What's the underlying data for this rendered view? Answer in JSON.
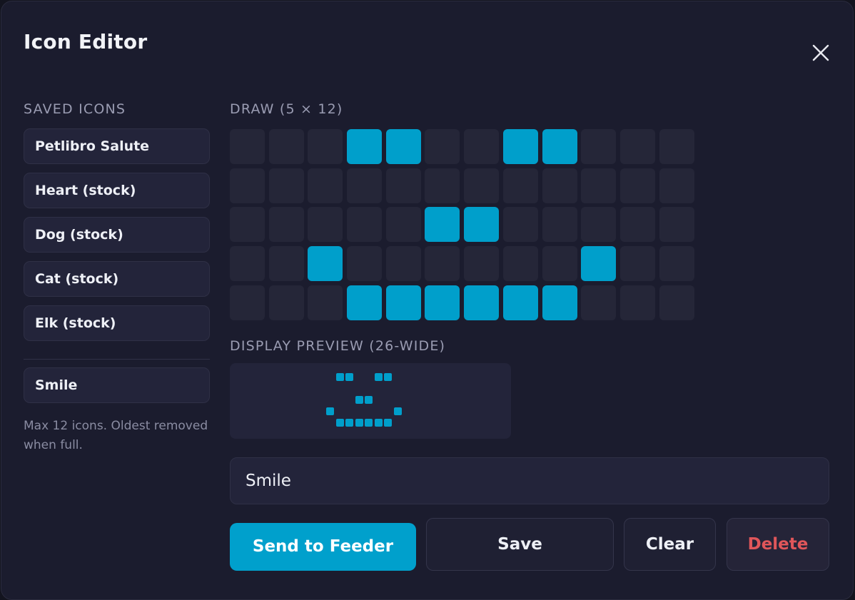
{
  "modal": {
    "title": "Icon Editor",
    "close_icon": "close-icon"
  },
  "sidebar": {
    "section_label": "SAVED ICONS",
    "items": [
      {
        "label": "Petlibro Salute"
      },
      {
        "label": "Heart (stock)"
      },
      {
        "label": "Dog (stock)"
      },
      {
        "label": "Cat (stock)"
      },
      {
        "label": "Elk (stock)"
      }
    ],
    "current": {
      "label": "Smile"
    },
    "hint": "Max 12 icons. Oldest removed when full."
  },
  "draw": {
    "section_label": "DRAW (5 × 12)",
    "rows": 5,
    "cols": 12,
    "on_color": "#009fcb",
    "off_color": "#252638",
    "pixels": [
      [
        0,
        0,
        0,
        1,
        1,
        0,
        0,
        1,
        1,
        0,
        0,
        0
      ],
      [
        0,
        0,
        0,
        0,
        0,
        0,
        0,
        0,
        0,
        0,
        0,
        0
      ],
      [
        0,
        0,
        0,
        0,
        0,
        1,
        1,
        0,
        0,
        0,
        0,
        0
      ],
      [
        0,
        0,
        1,
        0,
        0,
        0,
        0,
        0,
        0,
        1,
        0,
        0
      ],
      [
        0,
        0,
        0,
        1,
        1,
        1,
        1,
        1,
        1,
        0,
        0,
        0
      ]
    ]
  },
  "preview": {
    "section_label": "DISPLAY PREVIEW (26-WIDE)",
    "pixels": [
      [
        0,
        1,
        1,
        0,
        0,
        1,
        1,
        0,
        0
      ],
      [
        0,
        0,
        0,
        0,
        0,
        0,
        0,
        0,
        0
      ],
      [
        0,
        0,
        0,
        1,
        1,
        0,
        0,
        0,
        0
      ],
      [
        1,
        0,
        0,
        0,
        0,
        0,
        0,
        1,
        0
      ],
      [
        0,
        1,
        1,
        1,
        1,
        1,
        1,
        0,
        0
      ]
    ]
  },
  "name_input": {
    "value": "Smile"
  },
  "actions": {
    "send_label": "Send to Feeder",
    "save_label": "Save",
    "clear_label": "Clear",
    "delete_label": "Delete"
  },
  "colors": {
    "accent": "#00a0cc",
    "danger": "#e0565a"
  }
}
